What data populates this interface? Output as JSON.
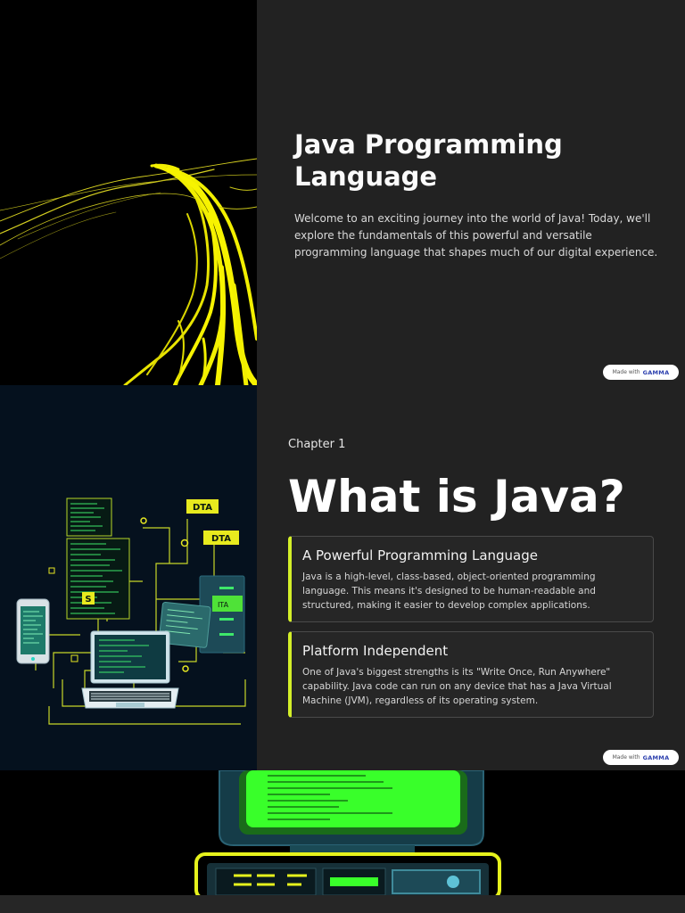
{
  "slide1": {
    "image": "yellow-glowing-river-illustration",
    "title": "Java Programming Language",
    "body": "Welcome to an exciting journey into the world of Java! Today, we'll explore the fundamentals of this powerful and versatile programming language that shapes much of our digital experience.",
    "badge": {
      "prefix": "Made with",
      "brand": "GAMMA"
    }
  },
  "slide2": {
    "image": "devices-circuit-network-illustration",
    "chapter": "Chapter 1",
    "title": "What is Java?",
    "cards": [
      {
        "title": "A Powerful Programming Language",
        "text": "Java is a high-level, class-based, object-oriented programming language. This means it's designed to be human-readable and structured, making it easier to develop complex applications."
      },
      {
        "title": "Platform Independent",
        "text": "One of Java's biggest strengths is its \"Write Once, Run Anywhere\" capability. Java code can run on any device that has a Java Virtual Machine (JVM), regardless of its operating system."
      }
    ],
    "image_labels": [
      "DTA",
      "DTA",
      "ITA",
      "S"
    ],
    "badge": {
      "prefix": "Made with",
      "brand": "GAMMA"
    }
  },
  "slide3": {
    "image": "retro-green-computer-terminal-illustration"
  },
  "colors": {
    "accent": "#d4ef29",
    "slide_bg": "#222222",
    "terminal_green": "#39ff2a"
  }
}
